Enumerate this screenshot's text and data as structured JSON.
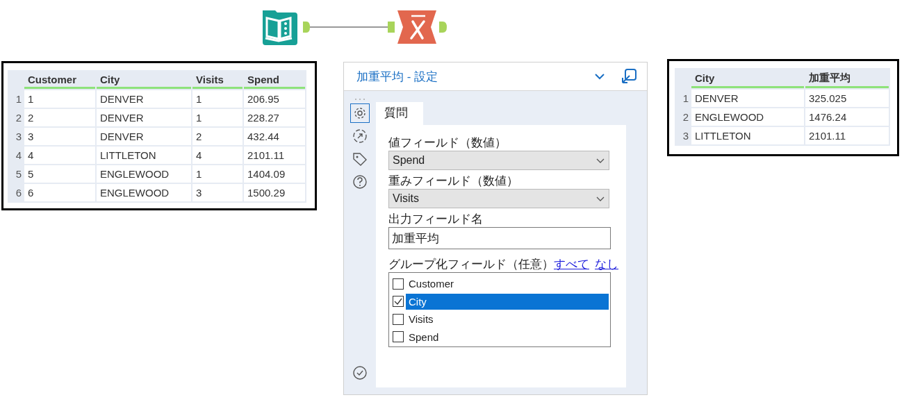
{
  "workflow": {
    "nodes": [
      {
        "kind": "input"
      },
      {
        "kind": "weighted_average"
      }
    ]
  },
  "input_table": {
    "columns": [
      "Customer",
      "City",
      "Visits",
      "Spend"
    ],
    "rows": [
      {
        "index": "1",
        "cells": [
          "1",
          "DENVER",
          "1",
          "206.95"
        ]
      },
      {
        "index": "2",
        "cells": [
          "2",
          "DENVER",
          "1",
          "228.27"
        ]
      },
      {
        "index": "3",
        "cells": [
          "3",
          "DENVER",
          "2",
          "432.44"
        ]
      },
      {
        "index": "4",
        "cells": [
          "4",
          "LITTLETON",
          "4",
          "2101.11"
        ]
      },
      {
        "index": "5",
        "cells": [
          "5",
          "ENGLEWOOD",
          "1",
          "1404.09"
        ]
      },
      {
        "index": "6",
        "cells": [
          "6",
          "ENGLEWOOD",
          "3",
          "1500.29"
        ]
      }
    ]
  },
  "config_panel": {
    "title": "加重平均 - 設定",
    "sidebar": [
      {
        "kind": "settings",
        "selected": true
      },
      {
        "kind": "connection",
        "selected": false
      },
      {
        "kind": "tag",
        "selected": false
      },
      {
        "kind": "help",
        "selected": false
      }
    ],
    "tabs": [
      {
        "label": "質問",
        "selected": true
      }
    ],
    "value_field": {
      "label": "値フィールド（数値）",
      "value": "Spend"
    },
    "weight_field": {
      "label": "重みフィールド（数値）",
      "value": "Visits"
    },
    "output_name": {
      "label": "出力フィールド名",
      "value": "加重平均"
    },
    "group_by": {
      "label": "グループ化フィールド（任意）",
      "links": [
        "すべて",
        "なし"
      ],
      "options": [
        {
          "label": "Customer",
          "checked": false,
          "selected": false
        },
        {
          "label": "City",
          "checked": true,
          "selected": true
        },
        {
          "label": "Visits",
          "checked": false,
          "selected": false
        },
        {
          "label": "Spend",
          "checked": false,
          "selected": false
        }
      ]
    }
  },
  "output_table": {
    "columns": [
      "City",
      "加重平均"
    ],
    "rows": [
      {
        "index": "1",
        "cells": [
          "DENVER",
          "325.025"
        ]
      },
      {
        "index": "2",
        "cells": [
          "ENGLEWOOD",
          "1476.24"
        ]
      },
      {
        "index": "3",
        "cells": [
          "LITTLETON",
          "2101.11"
        ]
      }
    ]
  }
}
